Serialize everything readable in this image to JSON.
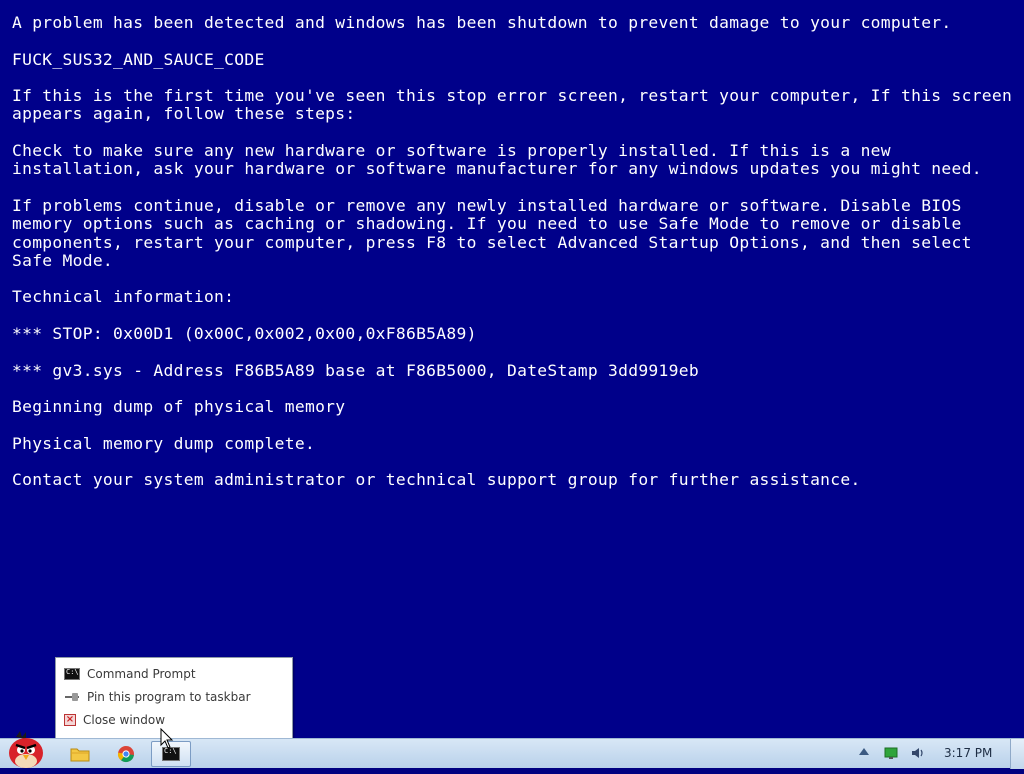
{
  "bsod": {
    "lines": [
      "A problem has been detected and windows has been shutdown to prevent damage to your computer.",
      "FUCK_SUS32_AND_SAUCE_CODE",
      "If this is the first time you've seen this stop error screen, restart your computer, If this screen appears again, follow these steps:",
      "Check to make sure any new hardware or software is properly installed. If this is a new installation, ask your hardware or software manufacturer for any windows updates you might need.",
      "If problems continue, disable or remove any newly installed hardware or software. Disable BIOS memory options such as caching or shadowing. If you need to use Safe Mode to remove or disable components, restart your computer, press F8 to select Advanced Startup Options, and then select Safe Mode.",
      "Technical information:",
      "*** STOP: 0x00D1 (0x00C,0x002,0x00,0xF86B5A89)",
      "*** gv3.sys - Address F86B5A89 base at F86B5000, DateStamp 3dd9919eb",
      "Beginning dump of physical memory",
      "Physical memory dump complete.",
      "Contact your system administrator or technical support group for further assistance."
    ]
  },
  "jumplist": {
    "items": [
      {
        "label": "Command Prompt",
        "icon": "command-prompt-icon"
      },
      {
        "label": "Pin this program to taskbar",
        "icon": "pin-icon"
      },
      {
        "label": "Close window",
        "icon": "close-icon"
      }
    ]
  },
  "taskbar": {
    "clock": "3:17 PM",
    "pinned": [
      "angry-birds-start-icon",
      "folder-icon",
      "chrome-icon",
      "command-prompt-icon"
    ]
  },
  "colors": {
    "bsod_background": "#00008a",
    "bsod_text": "#ffffff",
    "taskbar": "#c8dcf0"
  }
}
